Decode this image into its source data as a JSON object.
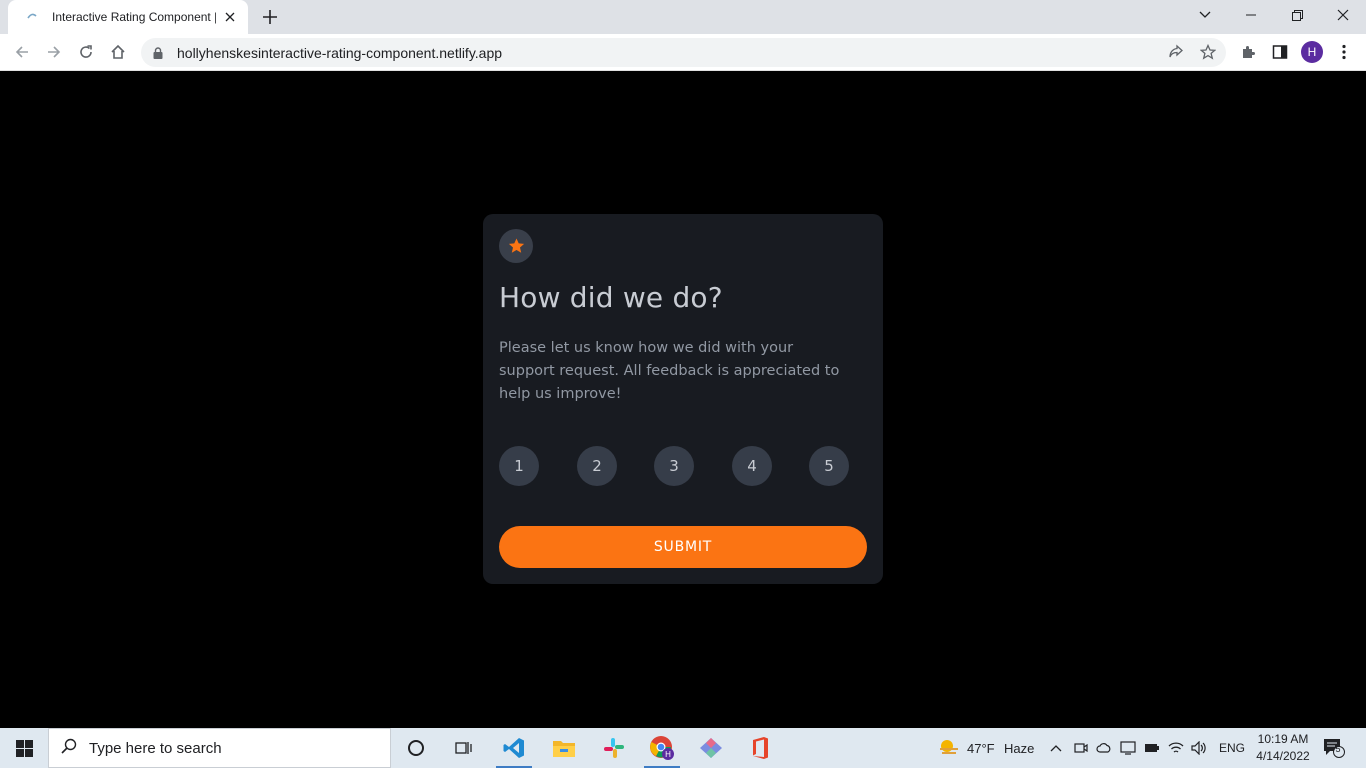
{
  "browser": {
    "tab_title": "Interactive Rating Component | F",
    "url": "hollyhenskesinteractive-rating-component.netlify.app",
    "profile_initial": "H"
  },
  "card": {
    "icon": "star-icon",
    "heading": "How did we do?",
    "description": "Please let us know how we did with your support request. All feedback is appreciated to help us improve!",
    "ratings": [
      "1",
      "2",
      "3",
      "4",
      "5"
    ],
    "submit_label": "SUBMIT",
    "accent_color": "#fb7413",
    "card_color": "#181b21",
    "circle_color": "#363d49"
  },
  "taskbar": {
    "search_placeholder": "Type here to search",
    "weather_temp": "47°F",
    "weather_condition": "Haze",
    "language": "ENG",
    "time": "10:19 AM",
    "date": "4/14/2022",
    "notification_count": "5"
  }
}
